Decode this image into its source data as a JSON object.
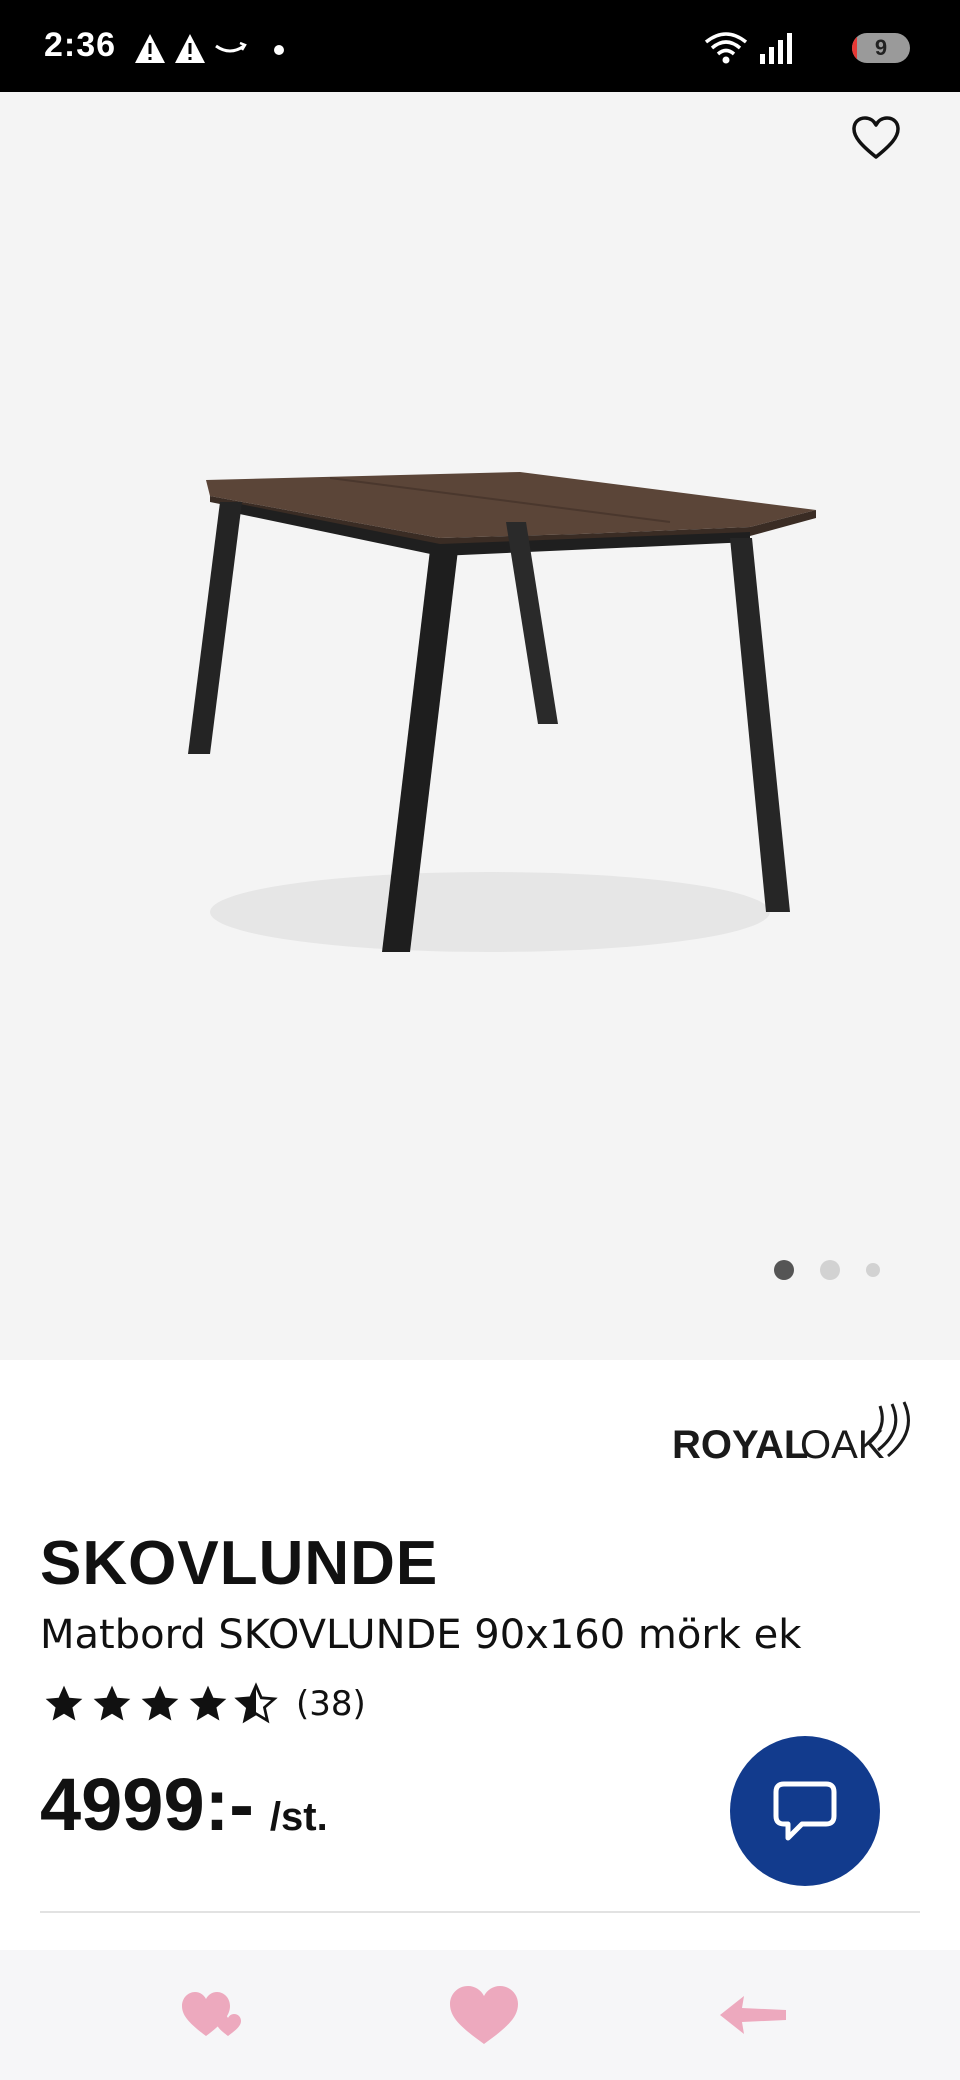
{
  "status_bar": {
    "time": "2:36",
    "left_icons": [
      "warning-icon",
      "warning-icon",
      "amazon-smile-icon",
      "dot-icon"
    ],
    "right_icons": [
      "wifi-icon",
      "signal-icon",
      "battery-icon"
    ],
    "battery_level": "9"
  },
  "gallery": {
    "favorite_icon": "heart-outline-icon",
    "image_alt": "dark oak dining table with black legs",
    "pagination": {
      "total": 3,
      "active_index": 0
    }
  },
  "product": {
    "brand": "ROYALOAK",
    "title": "SKOVLUNDE",
    "subtitle": "Matbord SKOVLUNDE 90x160 mörk ek",
    "rating": {
      "value": 4.5,
      "max": 5,
      "count_label": "(38)"
    },
    "price": "4999:-",
    "price_unit": "/st."
  },
  "chat": {
    "icon": "chat-bubble-icon"
  },
  "bottom": {
    "icons": [
      "hearts-icon",
      "heart-icon",
      "arrow-left-icon"
    ]
  },
  "colors": {
    "status_bg": "#000000",
    "gallery_bg": "#f4f4f4",
    "chat_button": "#123b8d",
    "heart_pink": "#eda9be",
    "battery_red": "#e53935"
  }
}
